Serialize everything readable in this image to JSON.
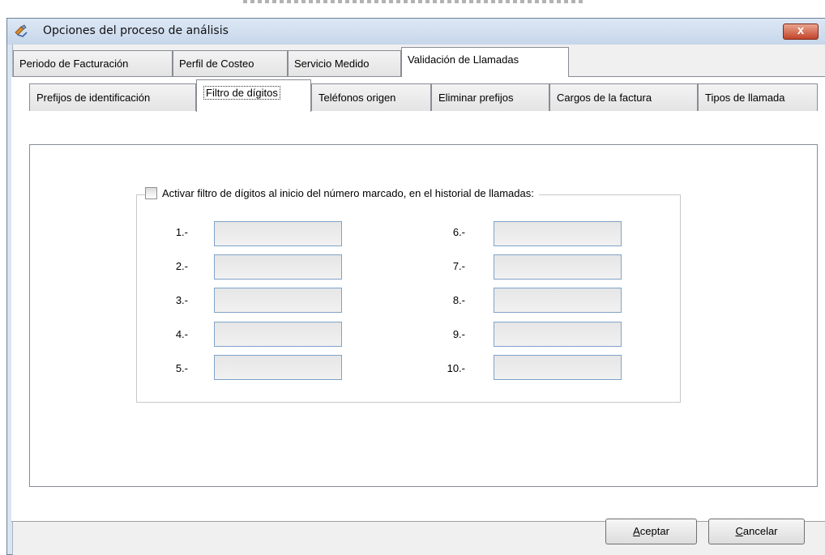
{
  "window": {
    "title": "Opciones del proceso de análisis",
    "close_label": "x"
  },
  "outer_tabs": [
    {
      "label": "Periodo de Facturación",
      "active": false
    },
    {
      "label": "Perfil de Costeo",
      "active": false
    },
    {
      "label": "Servicio Medido",
      "active": false
    },
    {
      "label": "Validación de Llamadas",
      "active": true
    }
  ],
  "inner_tabs": [
    {
      "label": "Prefijos de identificación",
      "active": false
    },
    {
      "label": "Filtro de dígitos",
      "active": true
    },
    {
      "label": "Teléfonos origen",
      "active": false
    },
    {
      "label": "Eliminar prefijos",
      "active": false
    },
    {
      "label": "Cargos de la factura",
      "active": false
    },
    {
      "label": "Tipos de llamada",
      "active": false
    }
  ],
  "filter": {
    "checkbox_label": "Activar filtro de dígitos al inicio del número marcado, en el historial de llamadas:",
    "checked": false,
    "fields": [
      {
        "label": "1.-",
        "value": ""
      },
      {
        "label": "2.-",
        "value": ""
      },
      {
        "label": "3.-",
        "value": ""
      },
      {
        "label": "4.-",
        "value": ""
      },
      {
        "label": "5.-",
        "value": ""
      },
      {
        "label": "6.-",
        "value": ""
      },
      {
        "label": "7.-",
        "value": ""
      },
      {
        "label": "8.-",
        "value": ""
      },
      {
        "label": "9.-",
        "value": ""
      },
      {
        "label": "10.-",
        "value": ""
      }
    ]
  },
  "buttons": {
    "accept_mnemonic": "A",
    "accept_rest": "ceptar",
    "cancel_mnemonic": "C",
    "cancel_rest": "ancelar"
  }
}
